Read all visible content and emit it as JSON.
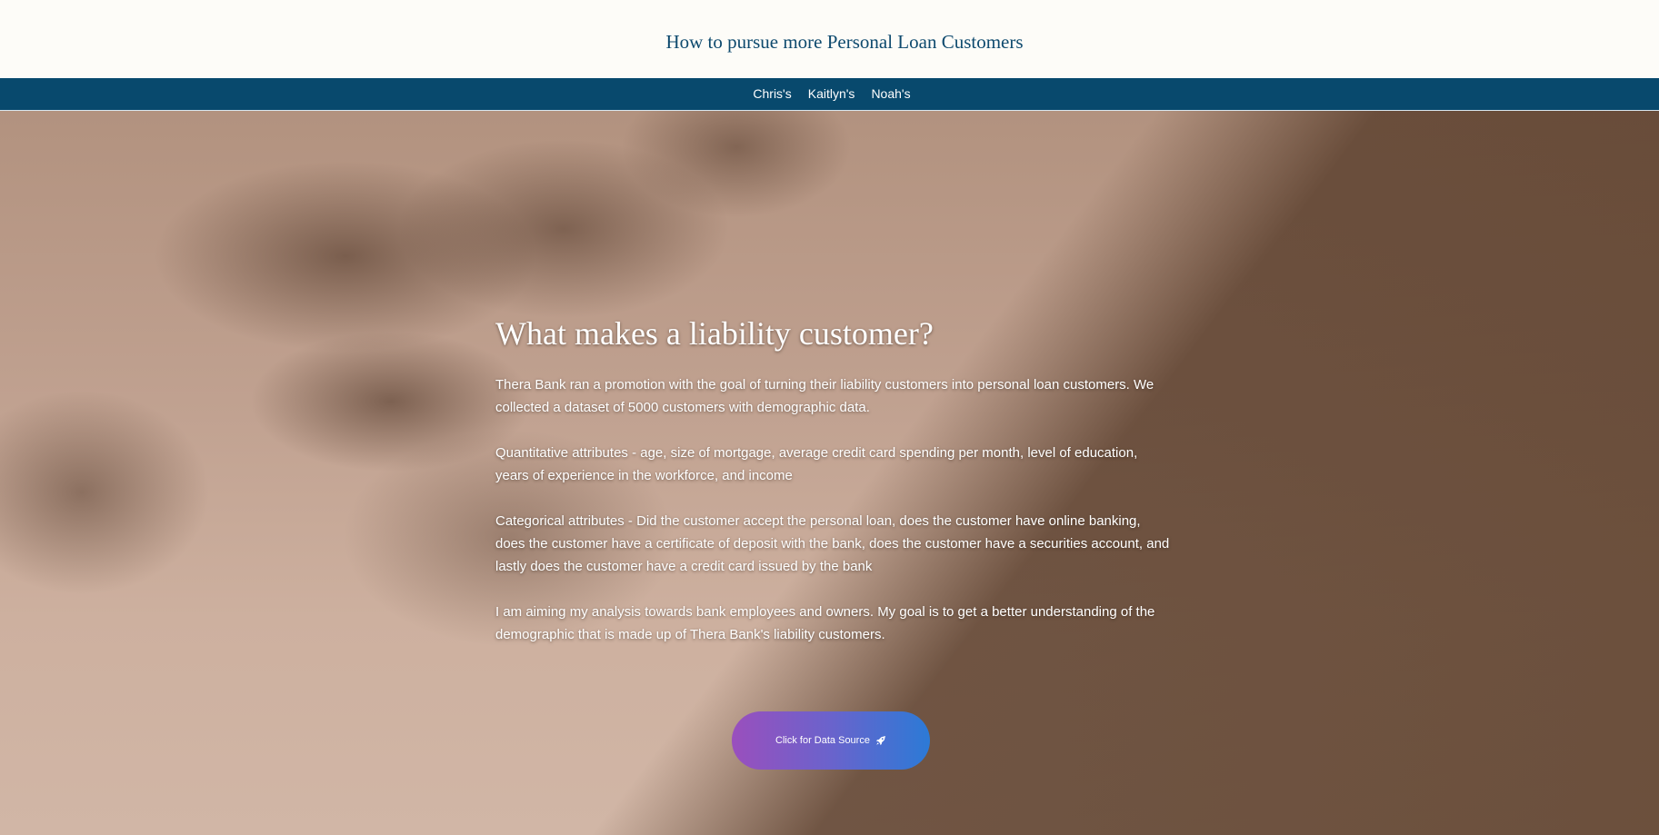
{
  "header": {
    "site_title": "How to pursue more Personal Loan Customers"
  },
  "nav": {
    "items": [
      {
        "label": "Chris's"
      },
      {
        "label": "Kaitlyn's"
      },
      {
        "label": "Noah's"
      }
    ]
  },
  "hero": {
    "heading": "What makes a liability customer?",
    "paragraphs": [
      "Thera Bank ran a promotion with the goal of turning their liability customers into personal loan customers. We collected a dataset of 5000 customers with demographic data.",
      "Quantitative attributes - age, size of mortgage, average credit card spending per month, level of education, years of experience in the workforce, and income",
      "Categorical attributes - Did the customer accept the personal loan, does the customer have online banking, does the customer have a certificate of deposit with the bank, does the customer have a securities account, and lastly does the customer have a credit card issued by the bank",
      "I am aiming my analysis towards bank employees and owners. My goal is to get a better understanding of the demographic that is made up of Thera Bank's liability customers."
    ],
    "cta_label": "Click for Data Source",
    "cta_icon": "rocket-icon"
  },
  "colors": {
    "nav_background": "#08496d",
    "title_color": "#0e4a6e",
    "cta_gradient_start": "#9a4fbd",
    "cta_gradient_end": "#2c7ad6"
  }
}
